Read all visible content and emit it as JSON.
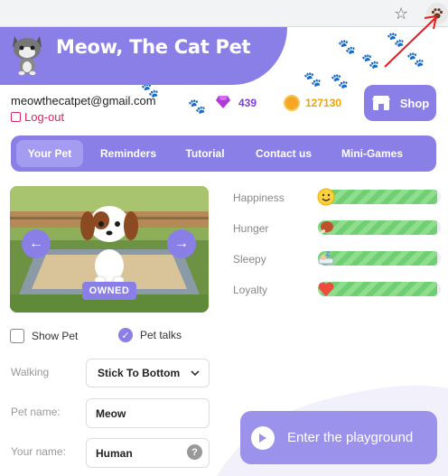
{
  "app": {
    "title": "Meow, The Cat Pet"
  },
  "account": {
    "email": "meowthecatpet@gmail.com",
    "logout_label": "Log-out"
  },
  "currency": {
    "gems": "439",
    "coins": "127130"
  },
  "shop": {
    "label": "Shop"
  },
  "nav": {
    "tabs": [
      {
        "label": "Your Pet",
        "active": true
      },
      {
        "label": "Reminders",
        "active": false
      },
      {
        "label": "Tutorial",
        "active": false
      },
      {
        "label": "Contact us",
        "active": false
      },
      {
        "label": "Mini-Games",
        "active": false
      }
    ]
  },
  "pet": {
    "owned_label": "OWNED"
  },
  "stats": [
    {
      "label": "Happiness",
      "icon": "smile-icon",
      "level": 0.97
    },
    {
      "label": "Hunger",
      "icon": "meat-icon",
      "level": 0.97
    },
    {
      "label": "Sleepy",
      "icon": "bed-icon",
      "level": 0.97
    },
    {
      "label": "Loyalty",
      "icon": "heart-icon",
      "level": 0.97
    }
  ],
  "options": {
    "show_pet": {
      "label": "Show Pet",
      "checked": false
    },
    "pet_talks": {
      "label": "Pet talks",
      "checked": true
    }
  },
  "form": {
    "walking_label": "Walking",
    "walking_value": "Stick To Bottom",
    "pet_name_label": "Pet name:",
    "pet_name_value": "Meow",
    "your_name_label": "Your name:",
    "your_name_value": "Human",
    "help_glyph": "?"
  },
  "playground": {
    "label": "Enter the playground"
  },
  "colors": {
    "accent": "#8a7fe6",
    "coin": "#f0a500",
    "gem": "#7b3fd6",
    "logout": "#e0245e",
    "bar_fill": "#6fcf72"
  }
}
